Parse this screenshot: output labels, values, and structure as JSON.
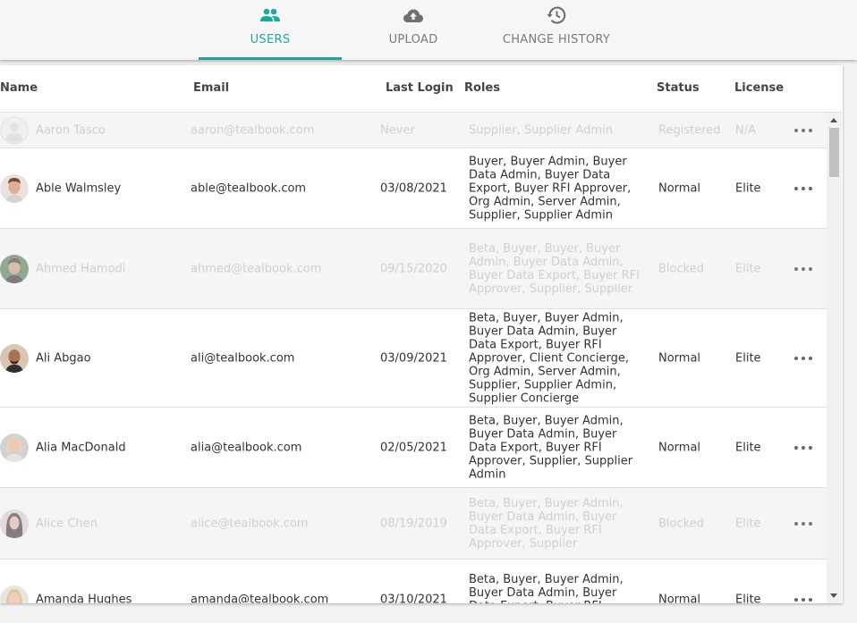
{
  "tabs": [
    {
      "label": "USERS",
      "icon": "people-icon",
      "active": true
    },
    {
      "label": "UPLOAD",
      "icon": "cloud-upload-icon",
      "active": false
    },
    {
      "label": "CHANGE HISTORY",
      "icon": "history-icon",
      "active": false
    }
  ],
  "colors": {
    "accent": "#1ea89d",
    "inactive_text": "#cfcfcf",
    "inactive_row": "#f5f5f5"
  },
  "table": {
    "columns": {
      "name": "Name",
      "email": "Email",
      "last_login": "Last Login",
      "roles": "Roles",
      "status": "Status",
      "license": "License"
    },
    "rows": [
      {
        "name": "Aaron Tasco",
        "email": "aaron@tealbook.com",
        "last_login": "Never",
        "roles": "Supplier, Supplier Admin",
        "status": "Registered",
        "license": "N/A",
        "avatar": "default-avatar-icon"
      },
      {
        "name": "Able Walmsley",
        "email": "able@tealbook.com",
        "last_login": "03/08/2021",
        "roles": "Buyer, Buyer Admin, Buyer Data Admin, Buyer Data Export, Buyer RFI Approver, Org Admin, Server Admin, Supplier, Supplier Admin",
        "status": "Normal",
        "license": "Elite",
        "avatar": "user-photo"
      },
      {
        "name": "Ahmed Hamodi",
        "email": "ahmed@tealbook.com",
        "last_login": "09/15/2020",
        "roles": "Beta, Buyer, Buyer, Buyer Admin, Buyer Data Admin, Buyer Data Export, Buyer RFI Approver, Supplier, Supplier",
        "status": "Blocked",
        "license": "Elite",
        "avatar": "user-photo"
      },
      {
        "name": "Ali Abgao",
        "email": "ali@tealbook.com",
        "last_login": "03/09/2021",
        "roles": "Beta, Buyer, Buyer Admin, Buyer Data Admin, Buyer Data Export, Buyer RFI Approver, Client Concierge, Org Admin, Server Admin, Supplier, Supplier Admin, Supplier Concierge",
        "status": "Normal",
        "license": "Elite",
        "avatar": "user-photo"
      },
      {
        "name": "Alia MacDonald",
        "email": "alia@tealbook.com",
        "last_login": "02/05/2021",
        "roles": "Beta, Buyer, Buyer Admin, Buyer Data Admin, Buyer Data Export, Buyer RFI Approver, Supplier, Supplier Admin",
        "status": "Normal",
        "license": "Elite",
        "avatar": "user-photo"
      },
      {
        "name": "Alice Chen",
        "email": "alice@tealbook.com",
        "last_login": "08/19/2019",
        "roles": "Beta, Buyer, Buyer Admin, Buyer Data Admin, Buyer Data Export, Buyer RFI Approver, Supplier",
        "status": "Blocked",
        "license": "Elite",
        "avatar": "user-photo"
      },
      {
        "name": "Amanda Hughes",
        "email": "amanda@tealbook.com",
        "last_login": "03/10/2021",
        "roles": "Beta, Buyer, Buyer Admin, Buyer Data Admin, Buyer Data Export, Buyer RFI Approver,",
        "status": "Normal",
        "license": "Elite",
        "avatar": "user-photo"
      }
    ]
  }
}
